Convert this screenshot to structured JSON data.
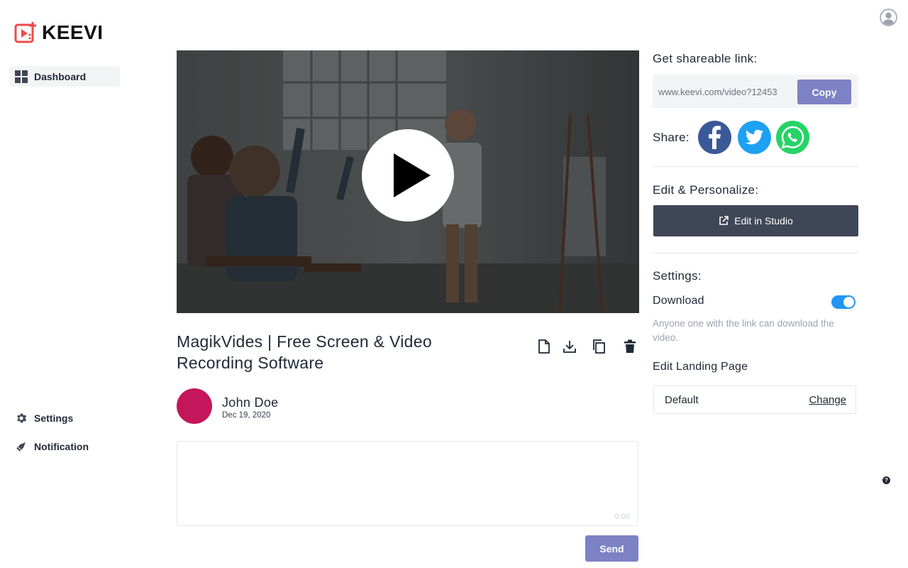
{
  "brand": {
    "name": "KEEVI",
    "accent": "#ee4b4b"
  },
  "sidebar": {
    "items": [
      {
        "label": "Dashboard",
        "icon": "grid-icon",
        "active": true
      },
      {
        "label": "Settings",
        "icon": "gear-icon"
      },
      {
        "label": "Notification",
        "icon": "bell-icon"
      }
    ]
  },
  "header": {
    "profile_icon": "user-circle-icon"
  },
  "video": {
    "title": "MagikVides | Free Screen & Video Recording Software",
    "play_icon": "play-icon",
    "actions": [
      "file-icon",
      "download-icon",
      "copy-icon",
      "trash-icon"
    ]
  },
  "author": {
    "name": "John Doe",
    "date": "Dec 19, 2020",
    "avatar_color": "#c4165a"
  },
  "comment": {
    "value": "",
    "timer": "0:00",
    "send_label": "Send"
  },
  "share_panel": {
    "link_heading": "Get shareable link:",
    "link_url": "www.keevi.com/video?12453",
    "copy_label": "Copy",
    "share_label": "Share:",
    "socials": [
      {
        "name": "facebook-icon",
        "color": "#3b5998"
      },
      {
        "name": "twitter-icon",
        "color": "#1da1f2"
      },
      {
        "name": "whatsapp-icon",
        "color": "#25d366"
      }
    ],
    "edit_heading": "Edit & Personalize:",
    "edit_button": "Edit in Studio",
    "settings_heading": "Settings:",
    "download_label": "Download",
    "download_enabled": true,
    "download_desc": "Anyone one with the link can download the video.",
    "landing_heading": "Edit Landing Page",
    "landing_value": "Default",
    "landing_change": "Change"
  },
  "help": {
    "label": "?"
  },
  "colors": {
    "button_primary": "#7c82c3",
    "button_dark": "#3f4655",
    "toggle_on": "#2196f3"
  }
}
